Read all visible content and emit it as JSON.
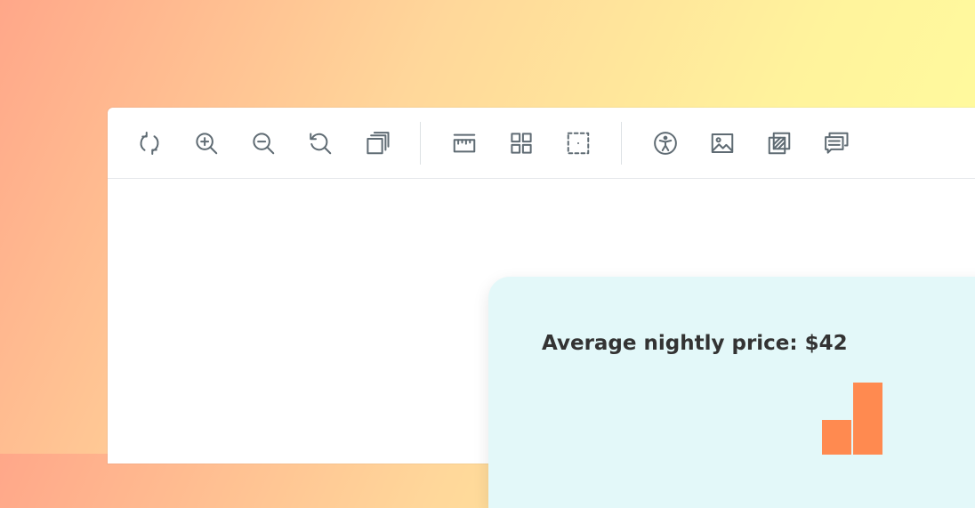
{
  "toolbar": {
    "groups": [
      [
        {
          "name": "refresh-icon",
          "label": "Refresh"
        },
        {
          "name": "zoom-in-icon",
          "label": "Zoom in"
        },
        {
          "name": "zoom-out-icon",
          "label": "Zoom out"
        },
        {
          "name": "reset-zoom-icon",
          "label": "Reset zoom"
        },
        {
          "name": "layers-icon",
          "label": "Layers"
        }
      ],
      [
        {
          "name": "ruler-icon",
          "label": "Ruler"
        },
        {
          "name": "grid-icon",
          "label": "Grid"
        },
        {
          "name": "select-area-icon",
          "label": "Select area"
        }
      ],
      [
        {
          "name": "accessibility-icon",
          "label": "Accessibility"
        },
        {
          "name": "image-icon",
          "label": "Image"
        },
        {
          "name": "overlay-icon",
          "label": "Overlay"
        },
        {
          "name": "comments-icon",
          "label": "Comments"
        }
      ]
    ]
  },
  "card": {
    "title": "Average nightly price: $42",
    "bar_color": "#ff8a50",
    "background": "#e3f8f9"
  },
  "chart_data": {
    "type": "bar",
    "categories": [
      "",
      ""
    ],
    "values": [
      26,
      54
    ]
  }
}
